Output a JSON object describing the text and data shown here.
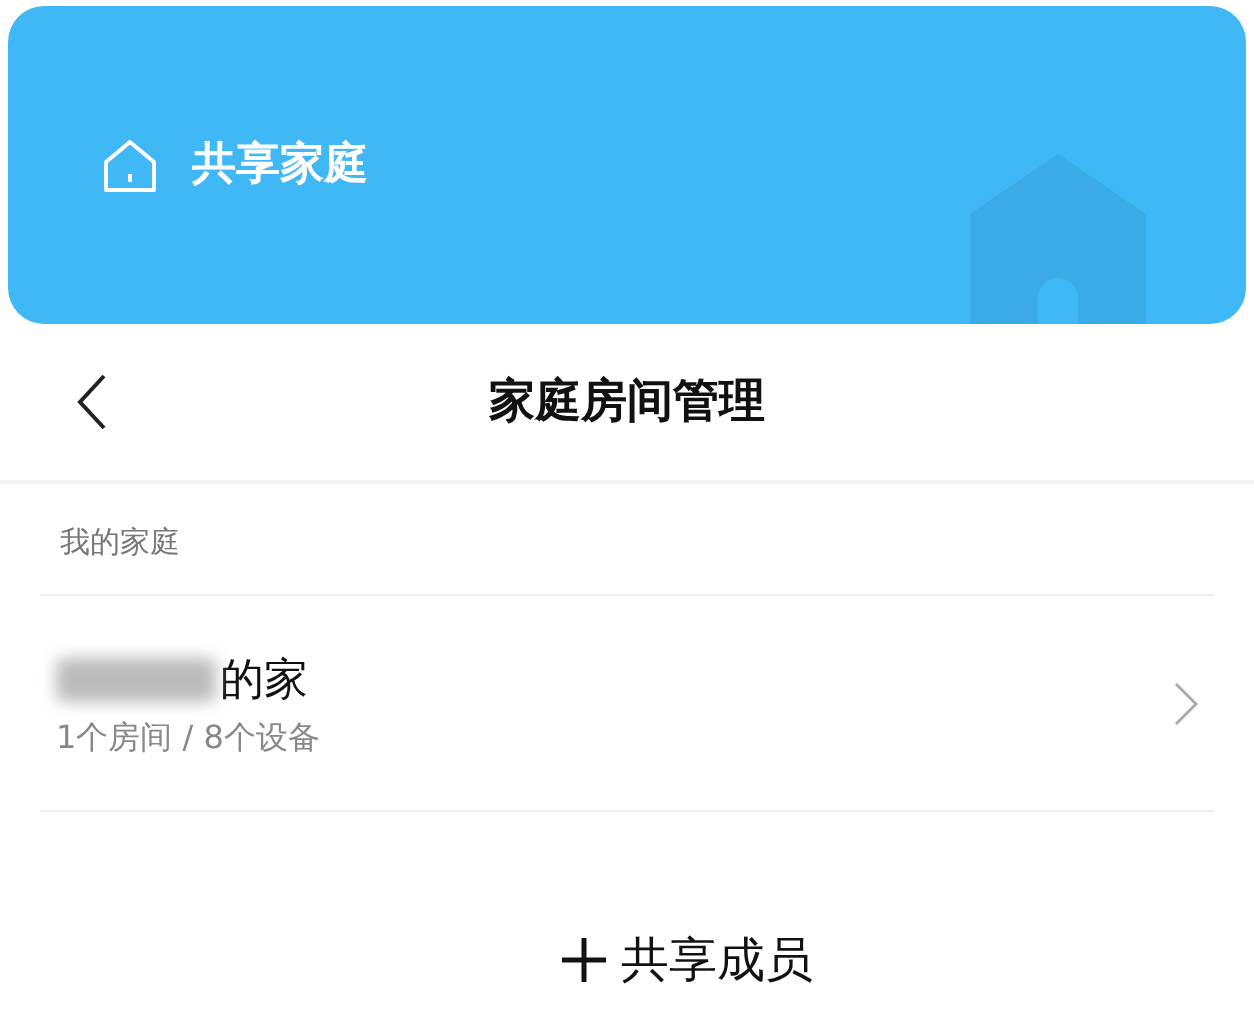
{
  "banner": {
    "title": "共享家庭"
  },
  "header": {
    "title": "家庭房间管理"
  },
  "section": {
    "label": "我的家庭"
  },
  "homes": [
    {
      "name": "的家",
      "name_redacted": true,
      "summary": "1个房间 / 8个设备"
    }
  ],
  "share_button": {
    "label": "共享成员"
  }
}
